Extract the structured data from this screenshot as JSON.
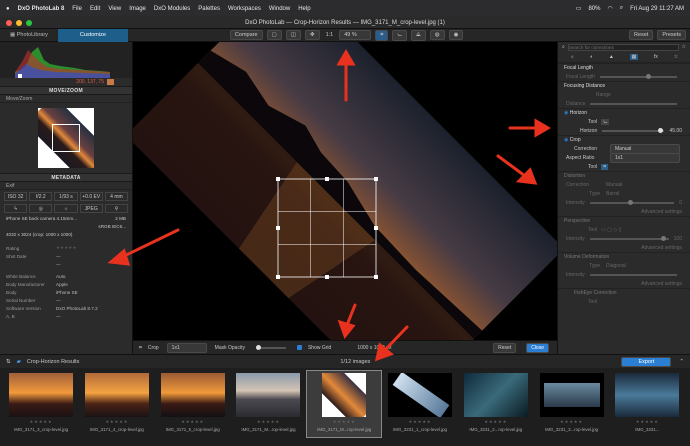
{
  "menubar": {
    "apple": "",
    "app_name": "DxO PhotoLab 8",
    "items": [
      "File",
      "Edit",
      "View",
      "Image",
      "DxO Modules",
      "Palettes",
      "Workspaces",
      "Window",
      "Help"
    ],
    "battery": "80%",
    "datetime": "Fri Aug 29  11:27 AM"
  },
  "window": {
    "title": "DxO PhotoLab — Crop-Horizon Results — IMG_3171_M_crop-level.jpg (1)"
  },
  "toolbar": {
    "tab_library": "PhotoLibrary",
    "tab_customize": "Customize",
    "compare": "Compare",
    "ratio": "1:1",
    "zoom": "49 %",
    "reset": "Reset",
    "presets": "Presets"
  },
  "left": {
    "histogram_values": "200, 137, 75",
    "move_zoom_header": "MOVE/ZOOM",
    "move_zoom_sub": "Move/Zoom",
    "metadata_header": "METADATA",
    "exif_sub": "Exif",
    "exif_boxes": [
      "ISO 32",
      "f/2.2",
      "1/93 s",
      "+0.0 EV",
      "4 mm"
    ],
    "exif_icons_label": "JPEG",
    "camera": "iPhone SE back camera 4.15mm...",
    "file_size": "2 MB",
    "color_space": "sRGB IEC6...",
    "dimensions": "4032 x 3024 (crop: 1000 x 1000)",
    "rows": [
      {
        "k": "Rating",
        "v": "★★★★★"
      },
      {
        "k": "Shot Date",
        "v": "—"
      },
      {
        "k": "",
        "v": "—"
      },
      {
        "k": "White Balance",
        "v": "Auto"
      },
      {
        "k": "Body Manufacturer",
        "v": "Apple"
      },
      {
        "k": "Body",
        "v": "iPhone SE"
      },
      {
        "k": "Serial Number",
        "v": "—"
      },
      {
        "k": "Software Version",
        "v": "DxO PhotoLab 8.7.2"
      },
      {
        "k": "A, B",
        "v": "—"
      }
    ]
  },
  "viewbar": {
    "crop": "Crop",
    "crop_ratio": "1x1",
    "mask_opacity": "Mask Opacity",
    "show_grid": "Show Grid",
    "size_readout": "1000 x 1000 px",
    "reset": "Reset",
    "close": "Close"
  },
  "right": {
    "search_placeholder": "Search for corrections",
    "focal_length": "Focal Length",
    "focal_length_sub": "Focal Length",
    "focusing_distance": "Focusing Distance",
    "range": "Range",
    "distance": "Distance",
    "horizon": "Horizon",
    "tool": "Tool",
    "horizon_label": "Horizon",
    "horizon_value": "45.00",
    "crop": "Crop",
    "correction": "Correction",
    "correction_value": "Manual",
    "aspect_ratio": "Aspect Ratio",
    "aspect_ratio_value": "1x1",
    "distortion": "Distortion",
    "dist_correction": "Correction",
    "dist_correction_value": "Manual",
    "dist_type": "Type",
    "dist_type_value": "Barrel",
    "intensity": "Intensity",
    "intensity_value": "0",
    "advanced": "Advanced settings",
    "perspective": "Perspective",
    "persp_tool": "Tool",
    "persp_intensity": "Intensity",
    "persp_value": "100",
    "volume_deformation": "Volume Deformation",
    "vol_type": "Type",
    "vol_type_value": "Diagonal",
    "vol_intensity": "Intensity",
    "fisheye": "FishEye Correction",
    "fisheye_tool": "Tool"
  },
  "filmbar": {
    "folder": "Crop-Horizon Results",
    "count": "1/12 images",
    "export": "Export"
  },
  "thumbnails": [
    {
      "cap": "IMG_3171_3_crop-level.jpg"
    },
    {
      "cap": "IMG_3171_4_crop-level.jpg"
    },
    {
      "cap": "IMG_3171_5_crop-level.jpg"
    },
    {
      "cap": "IMG_3171_M...rop-level.jpg"
    },
    {
      "cap": "IMG_3171_M...rop-level.jpg"
    },
    {
      "cap": "IMG_3231_1_crop-level.jpg"
    },
    {
      "cap": "IMG_3231_2...rop-level.jpg"
    },
    {
      "cap": "IMG_3231_3...rop-level.jpg"
    },
    {
      "cap": "IMG_3231..."
    }
  ]
}
